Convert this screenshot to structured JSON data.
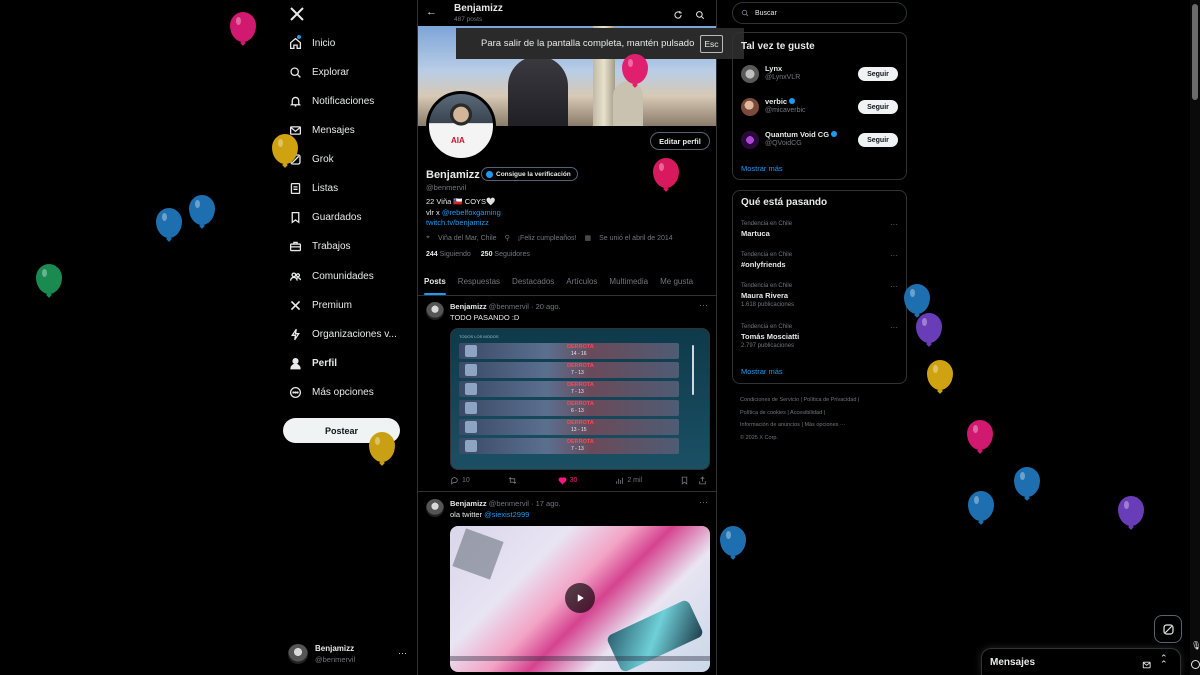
{
  "sidebar": {
    "items": [
      {
        "label": "Inicio",
        "icon": "home-icon"
      },
      {
        "label": "Explorar",
        "icon": "search-icon"
      },
      {
        "label": "Notificaciones",
        "icon": "bell-icon"
      },
      {
        "label": "Mensajes",
        "icon": "mail-icon"
      },
      {
        "label": "Grok",
        "icon": "grok-icon"
      },
      {
        "label": "Listas",
        "icon": "list-icon"
      },
      {
        "label": "Guardados",
        "icon": "bookmark-icon"
      },
      {
        "label": "Trabajos",
        "icon": "briefcase-icon"
      },
      {
        "label": "Comunidades",
        "icon": "people-icon"
      },
      {
        "label": "Premium",
        "icon": "x-icon"
      },
      {
        "label": "Organizaciones v...",
        "icon": "lightning-icon"
      },
      {
        "label": "Perfil",
        "icon": "person-icon"
      },
      {
        "label": "Más opciones",
        "icon": "more-circle-icon"
      }
    ],
    "post_label": "Postear",
    "account": {
      "name": "Benjamizz",
      "handle": "@benmervil"
    }
  },
  "header": {
    "name": "Benjamizz",
    "posts_count": "487 posts"
  },
  "fullscreen_notice": {
    "text": "Para salir de la pantalla completa, mantén pulsado",
    "key": "Esc"
  },
  "profile": {
    "edit_label": "Editar perfil",
    "name": "Benjamizz",
    "verify_label": "Consigue la verificación",
    "handle": "@benmervil",
    "bio_line1": "22 Viña 🇨🇱 COYS🤍",
    "bio_line2_prefix": "vlr x ",
    "bio_line2_link": "@rebelfoxgaming",
    "bio_link": "twitch.tv/benjamizz",
    "location": "Viña del Mar, Chile",
    "birthday": "¡Feliz cumpleaños!",
    "joined": "Se unió el abril de 2014",
    "following_count": "244",
    "following_label": "Siguiendo",
    "followers_count": "250",
    "followers_label": "Seguidores"
  },
  "tabs": [
    "Posts",
    "Respuestas",
    "Destacados",
    "Artículos",
    "Multimedia",
    "Me gusta"
  ],
  "posts": [
    {
      "name": "Benjamizz",
      "handle": "@benmervil",
      "date": "· 20 ago.",
      "text": "TODO PASANDO :D",
      "replies": "10",
      "reposts": "",
      "likes": "30",
      "views": "2 mil"
    },
    {
      "name": "Benjamizz",
      "handle": "@benmervil",
      "date": "· 17 ago.",
      "text_prefix": "ola twitter ",
      "text_link": "@siexist2999"
    }
  ],
  "match_rows": [
    {
      "result": "DERROTA",
      "score": "14 - 16"
    },
    {
      "result": "DERROTA",
      "score": "7 - 13"
    },
    {
      "result": "DERROTA",
      "score": "7 - 13"
    },
    {
      "result": "DERROTA",
      "score": "6 - 13"
    },
    {
      "result": "DERROTA",
      "score": "13 - 15"
    },
    {
      "result": "DERROTA",
      "score": "7 - 13"
    }
  ],
  "match_header": "TODOS LOS MODOS",
  "search": {
    "placeholder": "Buscar"
  },
  "suggestions": {
    "title": "Tal vez te guste",
    "follow_label": "Seguir",
    "users": [
      {
        "name": "Lynx",
        "handle": "@LynxVLR",
        "verified": false
      },
      {
        "name": "verbic",
        "handle": "@micaverbic",
        "verified": true
      },
      {
        "name": "Quantum Void CG",
        "handle": "@QVoidCG",
        "verified": true
      }
    ],
    "show_more": "Mostrar más"
  },
  "trends": {
    "title": "Qué está pasando",
    "items": [
      {
        "category": "Tendencia en Chile",
        "name": "Martuca",
        "count": ""
      },
      {
        "category": "Tendencia en Chile",
        "name": "#onlyfriends",
        "count": ""
      },
      {
        "category": "Tendencia en Chile",
        "name": "Maura Rivera",
        "count": "1.618 publicaciones"
      },
      {
        "category": "Tendencia en Chile",
        "name": "Tomás Mosciatti",
        "count": "2.797 publicaciones"
      }
    ],
    "show_more": "Mostrar más"
  },
  "footer": {
    "links": [
      "Condiciones de Servicio",
      "Política de Privacidad",
      "Política de cookies",
      "Accesibilidad",
      "Información de anuncios",
      "Más opciones ···"
    ],
    "copyright": "© 2025 X Corp."
  },
  "messages_drawer": {
    "title": "Mensajes"
  },
  "colors": {
    "accent": "#1d9bf0",
    "like": "#f91880",
    "bg": "#000000",
    "border": "#2f3336"
  }
}
